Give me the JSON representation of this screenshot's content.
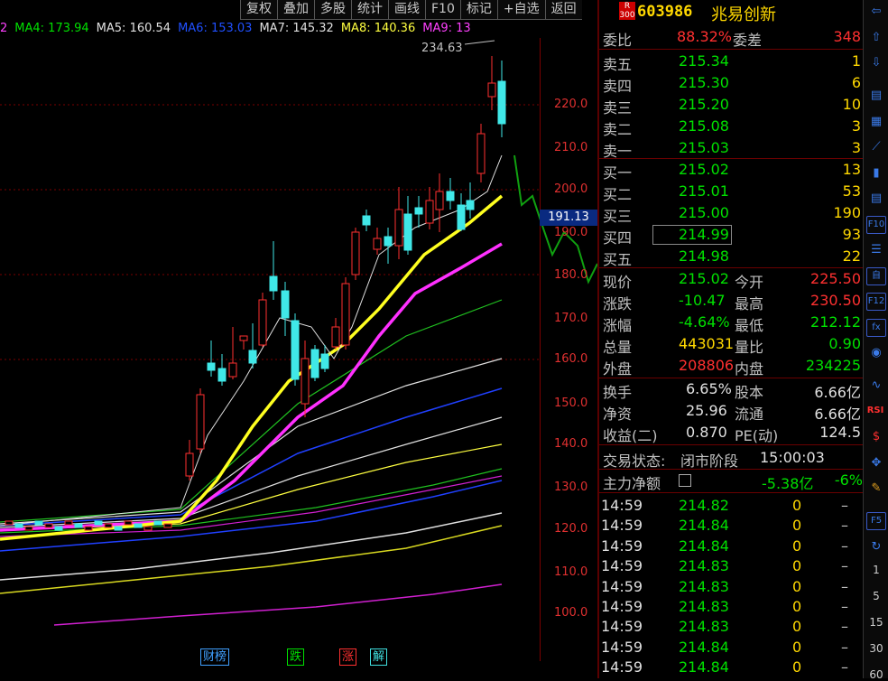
{
  "toolbar": {
    "items": [
      "复权",
      "叠加",
      "多股",
      "统计",
      "画线",
      "F10",
      "标记",
      "+自选",
      "返回"
    ]
  },
  "ma_legend": [
    {
      "label": "2",
      "color": "#ff40ff"
    },
    {
      "label": "MA4: 173.94",
      "color": "#00e000"
    },
    {
      "label": "MA5: 160.54",
      "color": "#e0e0e0"
    },
    {
      "label": "MA6: 153.03",
      "color": "#2050ff"
    },
    {
      "label": "MA7: 145.32",
      "color": "#e0e0e0"
    },
    {
      "label": "MA8: 140.36",
      "color": "#ffff40"
    },
    {
      "label": "MA9: 13",
      "color": "#ff40ff"
    }
  ],
  "peak_label": "234.63",
  "price_axis": {
    "ticks": [
      "220.0",
      "210.0",
      "200.0",
      "190.0",
      "180.0",
      "170.0",
      "160.0",
      "150.0",
      "140.0",
      "130.0",
      "120.0",
      "110.0",
      "100.0"
    ],
    "current": "191.13"
  },
  "bottom_badges": [
    {
      "label": "财榜",
      "color": "#40a0ff"
    },
    {
      "label": "跌",
      "color": "#00e000"
    },
    {
      "label": "涨",
      "color": "#ff3030"
    },
    {
      "label": "解",
      "color": "#40e0e0"
    }
  ],
  "stock": {
    "market_tag": "R 300",
    "code": "603986",
    "name": "兆易创新"
  },
  "order_book": {
    "weibi_label": "委比",
    "weibi": "88.32%",
    "weicha_label": "委差",
    "weicha": "348",
    "asks": [
      {
        "label": "卖五",
        "price": "215.34",
        "vol": "1"
      },
      {
        "label": "卖四",
        "price": "215.30",
        "vol": "6"
      },
      {
        "label": "卖三",
        "price": "215.20",
        "vol": "10"
      },
      {
        "label": "卖二",
        "price": "215.08",
        "vol": "3"
      },
      {
        "label": "卖一",
        "price": "215.03",
        "vol": "3"
      }
    ],
    "bids": [
      {
        "label": "买一",
        "price": "215.02",
        "vol": "13"
      },
      {
        "label": "买二",
        "price": "215.01",
        "vol": "53"
      },
      {
        "label": "买三",
        "price": "215.00",
        "vol": "190"
      },
      {
        "label": "买四",
        "price": "214.99",
        "vol": "93"
      },
      {
        "label": "买五",
        "price": "214.98",
        "vol": "22"
      }
    ]
  },
  "quote": [
    {
      "l1": "现价",
      "v1": "215.02",
      "c1": "green",
      "l2": "今开",
      "v2": "225.50",
      "c2": "red"
    },
    {
      "l1": "涨跌",
      "v1": "-10.47",
      "c1": "green",
      "l2": "最高",
      "v2": "230.50",
      "c2": "red"
    },
    {
      "l1": "涨幅",
      "v1": "-4.64%",
      "c1": "green",
      "l2": "最低",
      "v2": "212.12",
      "c2": "green"
    },
    {
      "l1": "总量",
      "v1": "443031",
      "c1": "yellow",
      "l2": "量比",
      "v2": "0.90",
      "c2": "green"
    },
    {
      "l1": "外盘",
      "v1": "208806",
      "c1": "red",
      "l2": "内盘",
      "v2": "234225",
      "c2": "green"
    }
  ],
  "fundamentals": [
    {
      "l1": "换手",
      "v1": "6.65%",
      "l2": "股本",
      "v2": "6.66亿"
    },
    {
      "l1": "净资",
      "v1": "25.96",
      "l2": "流通",
      "v2": "6.66亿"
    },
    {
      "l1": "收益(二)",
      "v1": "0.870",
      "l2": "PE(动)",
      "v2": "124.5"
    }
  ],
  "trade_status": {
    "label": "交易状态:",
    "phase": "闭市阶段",
    "time": "15:00:03"
  },
  "main_flow": {
    "label": "主力净额",
    "value": "-5.38亿",
    "pct": "-6%"
  },
  "ticks": [
    {
      "time": "14:59",
      "price": "214.82",
      "vol": "0",
      "flag": "–"
    },
    {
      "time": "14:59",
      "price": "214.84",
      "vol": "0",
      "flag": "–"
    },
    {
      "time": "14:59",
      "price": "214.84",
      "vol": "0",
      "flag": "–"
    },
    {
      "time": "14:59",
      "price": "214.83",
      "vol": "0",
      "flag": "–"
    },
    {
      "time": "14:59",
      "price": "214.83",
      "vol": "0",
      "flag": "–"
    },
    {
      "time": "14:59",
      "price": "214.83",
      "vol": "0",
      "flag": "–"
    },
    {
      "time": "14:59",
      "price": "214.83",
      "vol": "0",
      "flag": "–"
    },
    {
      "time": "14:59",
      "price": "214.84",
      "vol": "0",
      "flag": "–"
    },
    {
      "time": "14:59",
      "price": "214.84",
      "vol": "0",
      "flag": "–"
    }
  ],
  "iconbar": {
    "icons": [
      "arrow-left-icon",
      "arrow-up-icon",
      "arrow-down-icon",
      "chart-list-icon",
      "grid-icon",
      "line-chart-icon",
      "candle-icon",
      "table-icon",
      "f10-icon",
      "notes-icon",
      "self-icon",
      "f12-icon",
      "fx-icon",
      "circle-icon",
      "wave-icon",
      "rsi-icon",
      "dollar-icon",
      "move-icon",
      "pencil-icon",
      "f5-icon",
      "refresh-icon"
    ],
    "numbers": [
      "1",
      "5",
      "15",
      "30",
      "60"
    ],
    "box_labels": {
      "f10": "F10",
      "f12": "F12",
      "f5": "F5",
      "rsi": "RSI",
      "fx": "fx",
      "self": "自"
    }
  }
}
